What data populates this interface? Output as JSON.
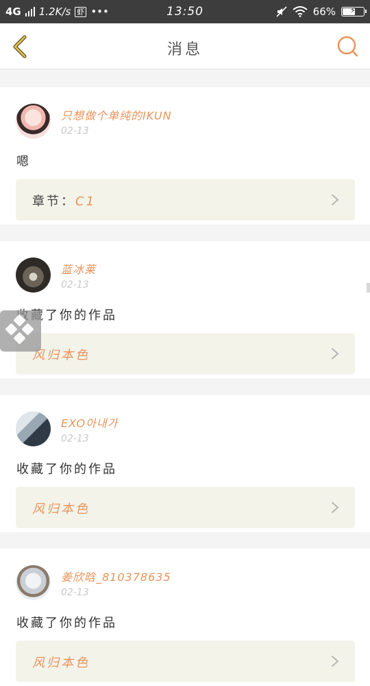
{
  "status_bar": {
    "network": "4G",
    "speed": "1.2K/s",
    "app_badge": "虾",
    "more": "•••",
    "time": "13:50",
    "battery_level": 0.66,
    "battery_text": "66%"
  },
  "header": {
    "title": "消息"
  },
  "colors": {
    "accent": "#e8935a",
    "back_icon": "#e8c23a",
    "card_ref_bg": "#f3f3ea"
  },
  "messages": [
    {
      "username": "只想做个单纯的IKUN",
      "date": "02-13",
      "text": "嗯",
      "ref_prefix": "章节：",
      "ref_value": "C1"
    },
    {
      "username": "蓝冰莱",
      "date": "02-13",
      "text": "收藏了你的作品",
      "ref_prefix": "",
      "ref_value": "风归本色"
    },
    {
      "username": "EXO아내가",
      "date": "02-13",
      "text": "收藏了你的作品",
      "ref_prefix": "",
      "ref_value": "风归本色"
    },
    {
      "username": "姜欣晗_810378635",
      "date": "02-13",
      "text": "收藏了你的作品",
      "ref_prefix": "",
      "ref_value": "风归本色"
    }
  ]
}
